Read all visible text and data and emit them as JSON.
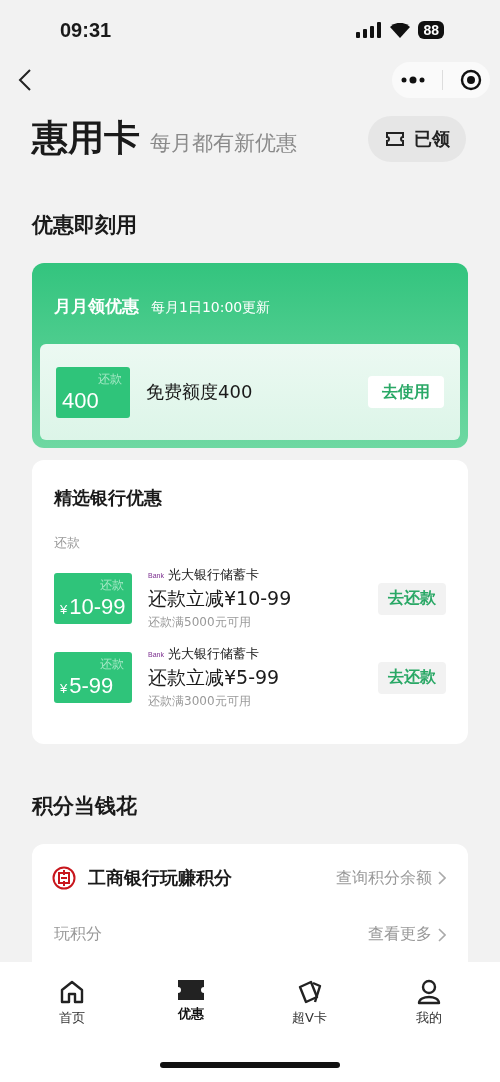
{
  "status_bar": {
    "time": "09:31",
    "battery": "88"
  },
  "header": {
    "title": "惠用卡",
    "subtitle": "每月都有新优惠",
    "claimed_button": "已领"
  },
  "section_instant": {
    "title": "优惠即刻用",
    "monthly": {
      "title": "月月领优惠",
      "note": "每月1日10:00更新",
      "coupon": {
        "tag": "还款",
        "amount": "400",
        "description": "免费额度400",
        "action": "去使用"
      }
    },
    "bank_offers": {
      "title": "精选银行优惠",
      "category": "还款",
      "items": [
        {
          "tag": "还款",
          "currency": "¥",
          "amount": "10-99",
          "logo_text": "Bank",
          "bank": "光大银行储蓄卡",
          "title": "还款立减¥10-99",
          "condition": "还款满5000元可用",
          "action": "去还款"
        },
        {
          "tag": "还款",
          "currency": "¥",
          "amount": "5-99",
          "logo_text": "Bank",
          "bank": "光大银行储蓄卡",
          "title": "还款立减¥5-99",
          "condition": "还款满3000元可用",
          "action": "去还款"
        }
      ]
    }
  },
  "section_points": {
    "title": "积分当钱花",
    "card": {
      "title": "工商银行玩赚积分",
      "link": "查询积分余额",
      "row_label": "玩积分",
      "row_link": "查看更多"
    }
  },
  "tab_bar": [
    {
      "label": "首页",
      "kind": "home",
      "selected": false
    },
    {
      "label": "优惠",
      "kind": "ticket",
      "selected": true
    },
    {
      "label": "超V卡",
      "kind": "cards",
      "selected": false
    },
    {
      "label": "我的",
      "kind": "person",
      "selected": false
    }
  ]
}
